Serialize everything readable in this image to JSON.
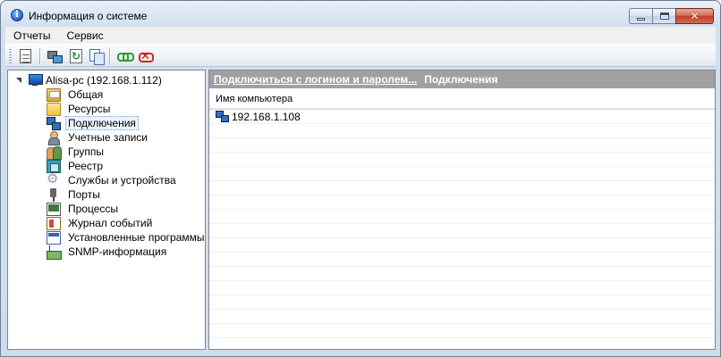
{
  "window": {
    "title": "Информация о системе",
    "app_icon": "info-icon",
    "close_glyph": "✕"
  },
  "menu": {
    "items": [
      "Отчеты",
      "Сервис"
    ]
  },
  "toolbar": {
    "icons": [
      "report-icon",
      "network-computer-icon",
      "refresh-icon",
      "copy-icon",
      "connect-icon",
      "disconnect-icon"
    ]
  },
  "tree": {
    "root_label": "Alisa-pc (192.168.1.112)",
    "items": [
      {
        "label": "Общая",
        "icon": "general-icon"
      },
      {
        "label": "Ресурсы",
        "icon": "folder-icon"
      },
      {
        "label": "Подключения",
        "icon": "connections-icon",
        "selected": true
      },
      {
        "label": "Учетные записи",
        "icon": "user-icon"
      },
      {
        "label": "Группы",
        "icon": "group-icon"
      },
      {
        "label": "Реестр",
        "icon": "registry-icon"
      },
      {
        "label": "Службы и устройства",
        "icon": "services-icon"
      },
      {
        "label": "Порты",
        "icon": "port-icon"
      },
      {
        "label": "Процессы",
        "icon": "process-icon"
      },
      {
        "label": "Журнал событий",
        "icon": "eventlog-icon"
      },
      {
        "label": "Установленные программы",
        "icon": "programs-icon"
      },
      {
        "label": "SNMP-информация",
        "icon": "snmp-icon"
      }
    ]
  },
  "content": {
    "header_link": "Подключиться с логином и паролем...",
    "header_title": "Подключения",
    "column_header": "Имя компьютера",
    "rows": [
      "192.168.1.108"
    ]
  }
}
